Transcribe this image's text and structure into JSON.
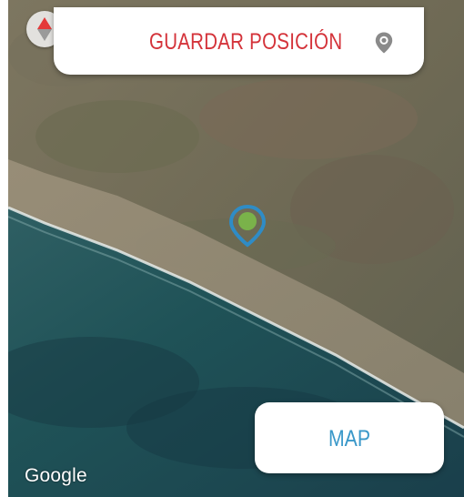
{
  "map": {
    "type": "satellite",
    "attribution": "Google"
  },
  "save_position": {
    "label": "GUARDAR POSICIÓN",
    "icon": "location-pin-icon"
  },
  "map_toggle": {
    "label": "MAP"
  },
  "marker": {
    "icon": "location-marker-icon"
  },
  "compass": {
    "icon": "compass-icon"
  },
  "colors": {
    "save_label": "#d4333a",
    "map_label": "#3a98c9",
    "marker_outline": "#2f8cc6",
    "marker_fill": "#7ab24a"
  }
}
